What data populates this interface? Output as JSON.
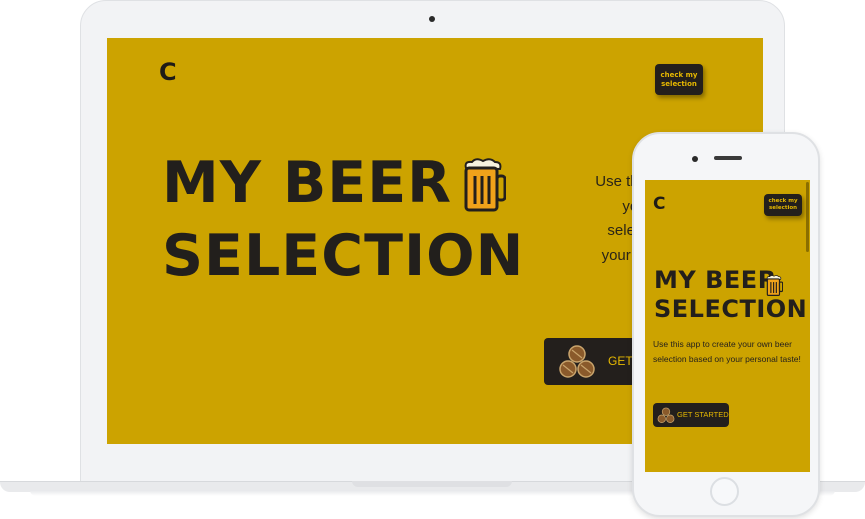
{
  "app": {
    "logo_text": "C",
    "title_line1": "MY BEER",
    "title_line2": "SELECTION",
    "check_button": "check my selection",
    "intro": "Use this app to create your own beer selection based on your personal taste!",
    "cta": "GET STARTED",
    "visible_desktop_intro_fragments": [
      "Use this app",
      "your",
      "selection",
      "your perso"
    ],
    "visible_desktop_cta_fragment": "GET"
  },
  "colors": {
    "brand_yellow": "#cca300",
    "dark": "#231f1c",
    "accent_text": "#e6b800"
  },
  "icons": [
    "beer-mug-icon",
    "barrels-icon",
    "logo-icon"
  ]
}
